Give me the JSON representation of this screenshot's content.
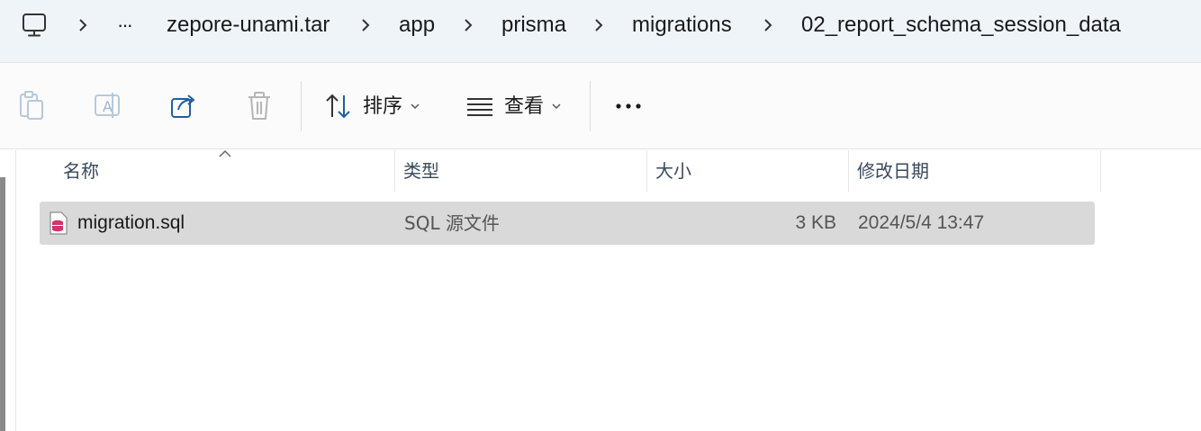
{
  "address_bar": {
    "breadcrumbs": [
      "zepore-unami.tar",
      "app",
      "prisma",
      "migrations",
      "02_report_schema_session_data"
    ],
    "overflow_label": "···"
  },
  "toolbar": {
    "sort_label": "排序",
    "view_label": "查看",
    "more_label": "···"
  },
  "columns": {
    "name": "名称",
    "type": "类型",
    "size": "大小",
    "modified": "修改日期"
  },
  "files": [
    {
      "name": "migration.sql",
      "type": "SQL 源文件",
      "size": "3 KB",
      "modified": "2024/5/4 13:47"
    }
  ]
}
